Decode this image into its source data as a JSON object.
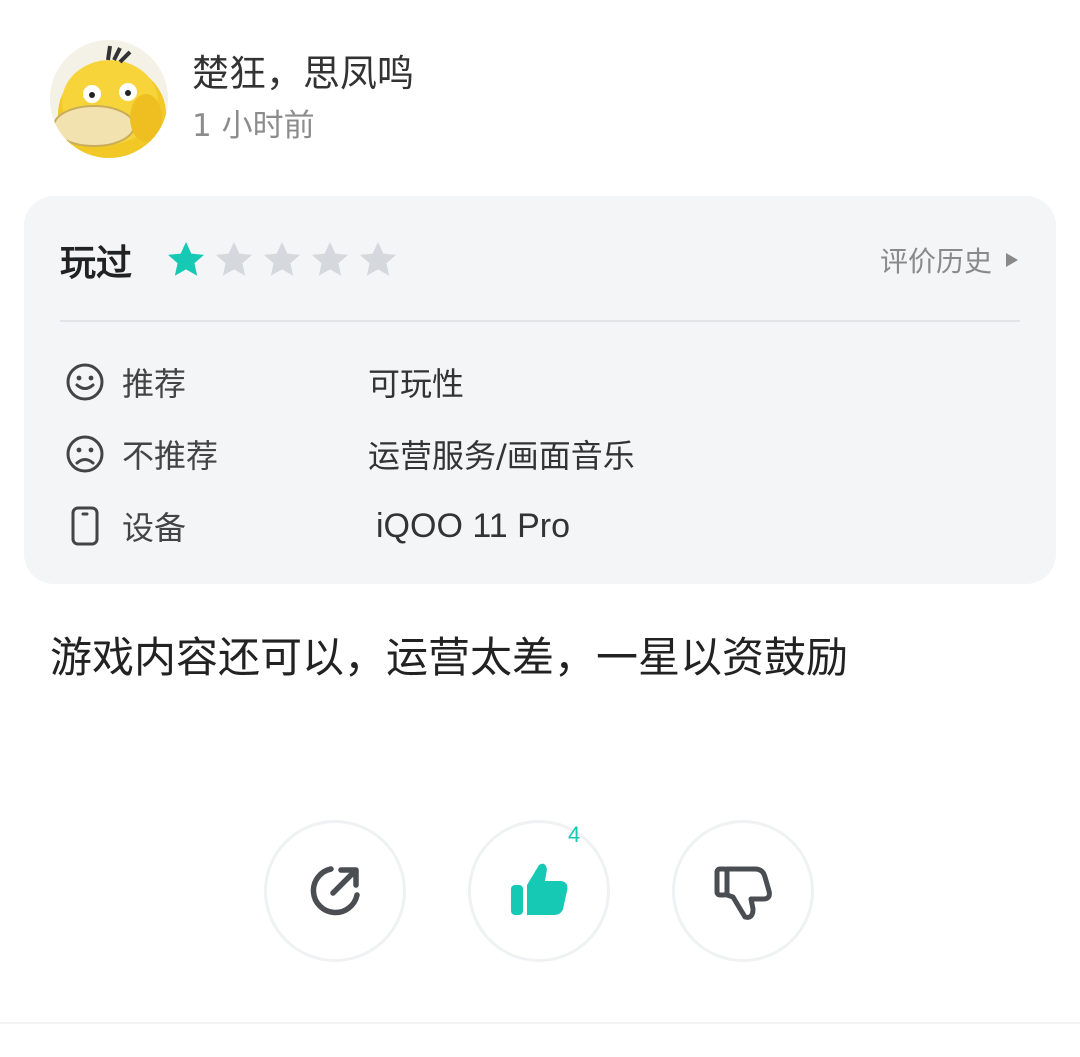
{
  "user": {
    "name": "楚狂，思凤鸣",
    "time": "1 小时前"
  },
  "review": {
    "status_label": "玩过",
    "rating": 1,
    "rating_max": 5,
    "history_label": "评价历史",
    "recommend_label": "推荐",
    "recommend_value": "可玩性",
    "not_recommend_label": "不推荐",
    "not_recommend_value": "运营服务/画面音乐",
    "device_label": "设备",
    "device_value": "iQOO 11 Pro",
    "text": "游戏内容还可以，运营太差，一星以资鼓励"
  },
  "actions": {
    "like_count": "4"
  },
  "colors": {
    "accent": "#16c9b4",
    "star_empty": "#d5d8dc",
    "card_bg": "#f3f5f7"
  },
  "icons": {
    "avatar": "psyduck-avatar",
    "recommend": "smile-icon",
    "not_recommend": "frown-icon",
    "device": "phone-icon",
    "history": "triangle-right-icon",
    "share": "share-icon",
    "like": "thumbs-up-icon",
    "dislike": "thumbs-down-icon"
  }
}
